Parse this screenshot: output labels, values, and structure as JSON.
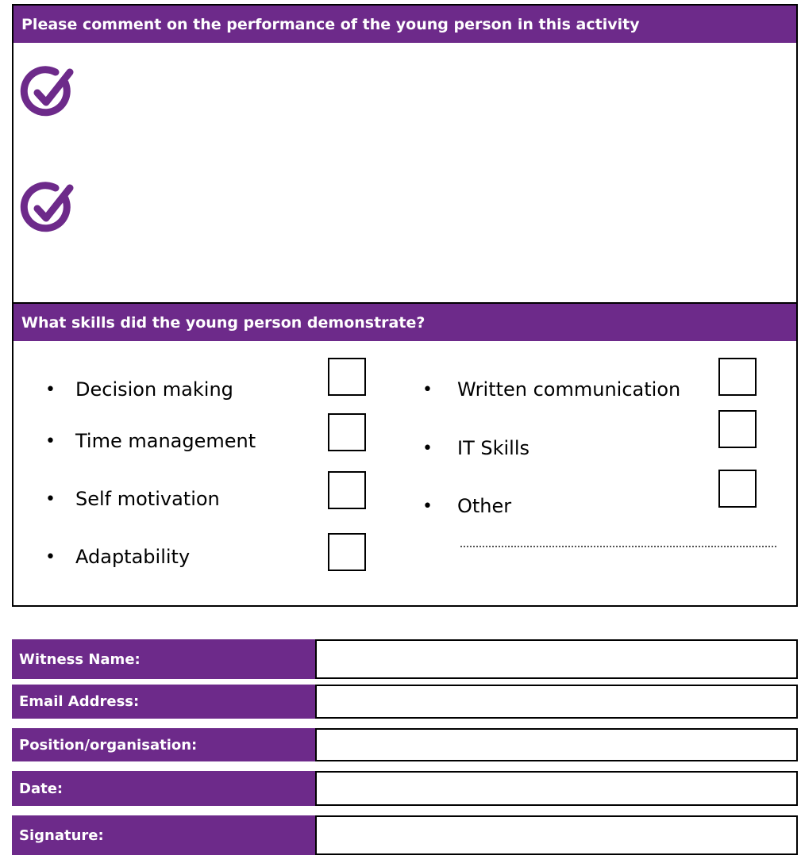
{
  "comment_section": {
    "header": "Please comment on the performance of the young person in this activity"
  },
  "skills_section": {
    "header": "What skills did the young  person demonstrate?",
    "bullet": "•",
    "left_skills": [
      "Decision making",
      "Time management",
      "Self motivation",
      "Adaptability"
    ],
    "right_skills": [
      "Written communication",
      "IT Skills",
      "Other"
    ]
  },
  "details": {
    "witness_name": "Witness Name:",
    "email": "Email Address:",
    "position": "Position/organisation:",
    "date": "Date:",
    "signature": "Signature:"
  },
  "colors": {
    "accent": "#6d2a8a"
  },
  "icons": {
    "check": "check-circle-icon"
  }
}
